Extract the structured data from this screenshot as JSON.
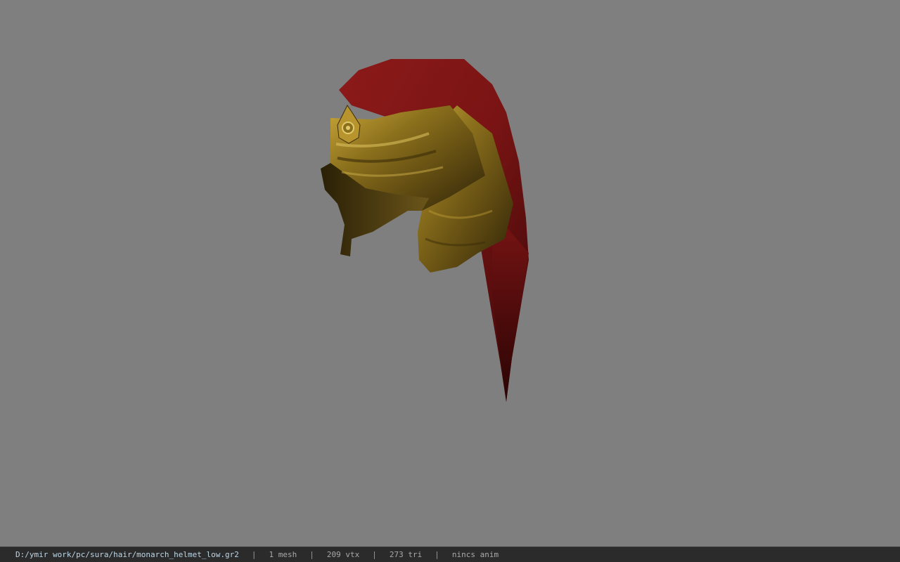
{
  "viewer": {
    "background_color": "#7f7f7f",
    "model": {
      "hair_color": "#7a1414",
      "metal_color": "#8a6f1c"
    }
  },
  "status_bar": {
    "file_path": "D:/ymir work/pc/sura/hair/monarch_helmet_low.gr2",
    "separator": "|",
    "mesh_count": "1 mesh",
    "vertex_count": "209 vtx",
    "triangle_count": "273 tri",
    "anim_info": "nincs anim"
  }
}
